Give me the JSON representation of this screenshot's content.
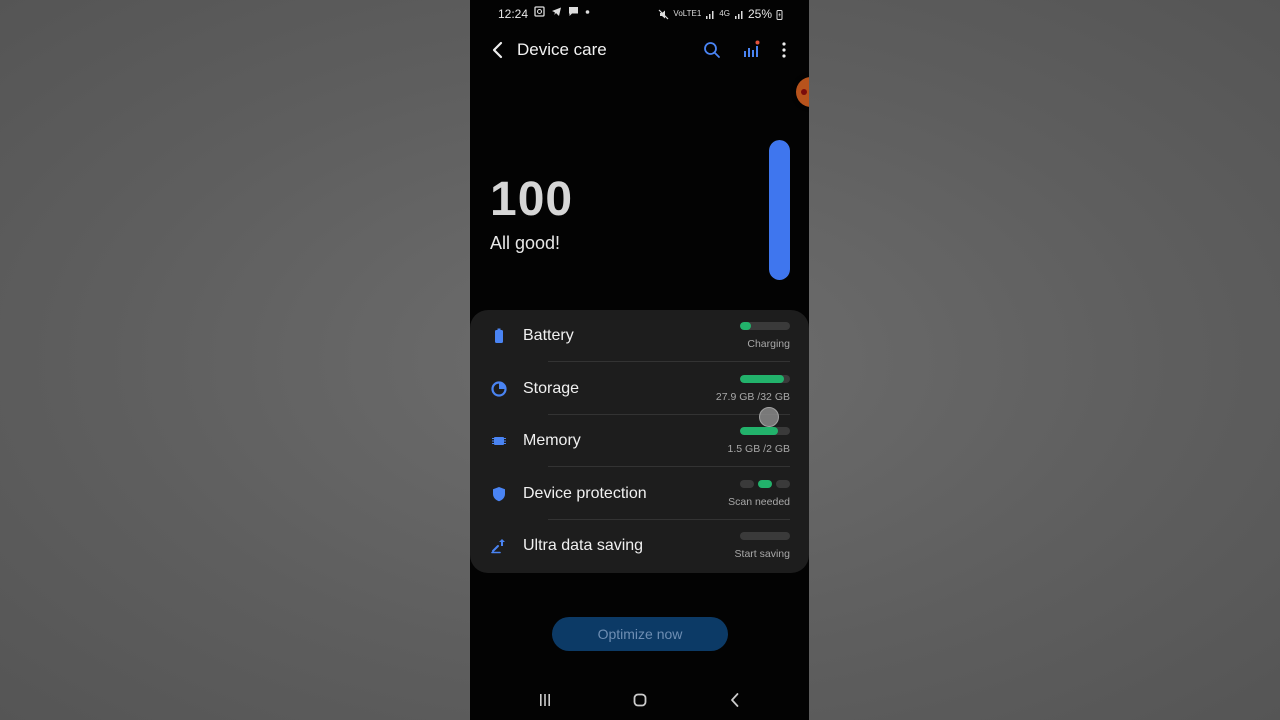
{
  "status_bar": {
    "time": "12:24",
    "left_icons": [
      "gallery-icon",
      "telegram-icon",
      "message-icon",
      "dot-icon"
    ],
    "right_icons": [
      "mute-icon",
      "volte-icon",
      "signal-icon",
      "4g-icon",
      "signal-icon"
    ],
    "volte_text": "VoLTE1",
    "network_text": "4G",
    "battery": "25%"
  },
  "app_bar": {
    "title": "Device care",
    "icons": [
      "back-icon",
      "search-icon",
      "stats-icon",
      "more-icon"
    ]
  },
  "score": {
    "value": "100",
    "status": "All good!",
    "fill_fraction": 1.0,
    "accent_color": "#3f76ee"
  },
  "items": [
    {
      "label": "Battery",
      "sub": "Charging",
      "icon": "battery-icon",
      "indicator": "bar",
      "fill": 0.22
    },
    {
      "label": "Storage",
      "sub": "27.9 GB /32 GB",
      "icon": "storage-icon",
      "indicator": "bar",
      "fill": 0.87
    },
    {
      "label": "Memory",
      "sub": "1.5 GB /2 GB",
      "icon": "memory-icon",
      "indicator": "bar",
      "fill": 0.75
    },
    {
      "label": "Device protection",
      "sub": "Scan needed",
      "icon": "shield-icon",
      "indicator": "dots",
      "active_dot": 1
    },
    {
      "label": "Ultra data saving",
      "sub": "Start saving",
      "icon": "data-saving-icon",
      "indicator": "bar",
      "fill": 0.0
    }
  ],
  "colors": {
    "good": "#22b26b",
    "accent": "#3f76ee",
    "button_bg": "#0c3a66"
  },
  "optimize_button": "Optimize now",
  "nav": [
    "recents-icon",
    "home-icon",
    "back-icon"
  ]
}
